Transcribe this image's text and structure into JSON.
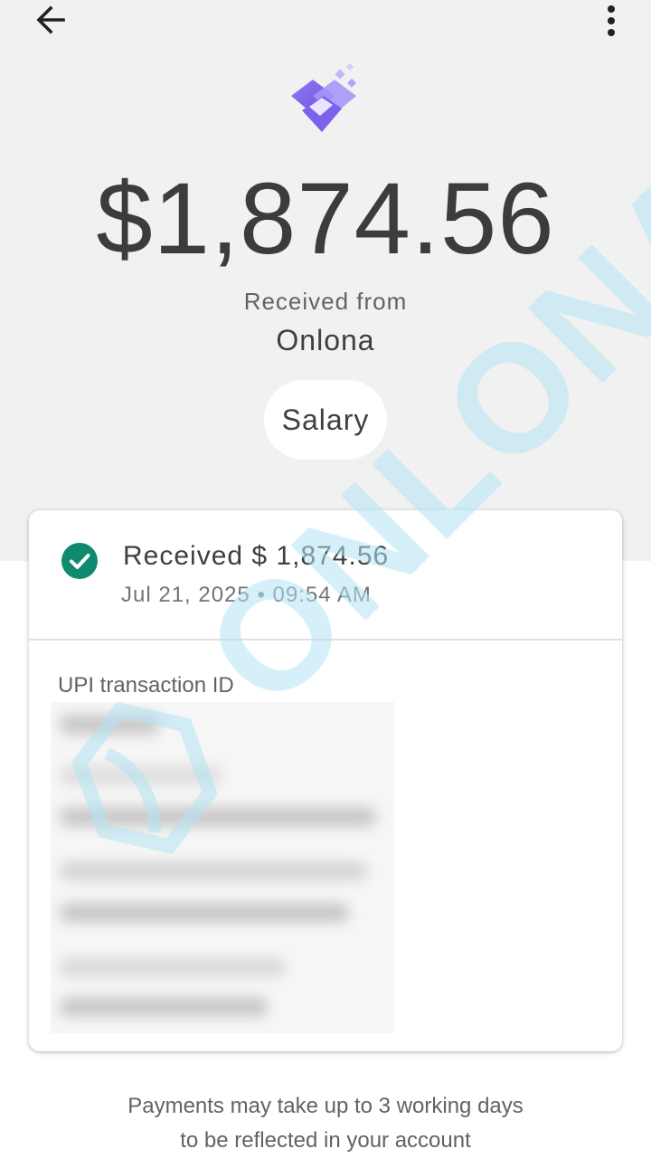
{
  "header": {
    "back_icon": "arrow-left-icon",
    "more_icon": "more-vertical-icon"
  },
  "brand_logo": "gradient-puzzle-logo",
  "transaction": {
    "amount": "$1,874.56",
    "received_from_label": "Received from",
    "sender": "Onlona",
    "note_chip": "Salary"
  },
  "card": {
    "status": "Received $ 1,874.56",
    "datetime": "Jul 21, 2025 • 09:54 AM",
    "status_icon": "check-circle-icon",
    "status_color": "#0f8a6e",
    "upi_label": "UPI transaction ID"
  },
  "footer": {
    "line1": "Payments may take up to 3 working days",
    "line2": "to be reflected in your account"
  },
  "watermark": {
    "text": "ONLONA",
    "color": "#b3e3f2"
  }
}
